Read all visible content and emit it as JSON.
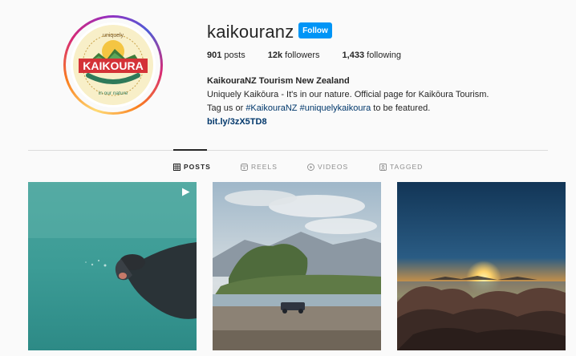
{
  "profile": {
    "username": "kaikouranz",
    "follow_label": "Follow",
    "logo_text": "KAIKOURA",
    "logo_top_text": "uniquely",
    "logo_bottom_text": "in our nature",
    "stats": {
      "posts_count": "901",
      "posts_label": "posts",
      "followers_count": "12k",
      "followers_label": "followers",
      "following_count": "1,433",
      "following_label": "following"
    },
    "bio": {
      "name": "KaikouraNZ Tourism New Zealand",
      "line1": "Uniquely Kaikōura - It's in our nature. Official page for Kaikōura Tourism.",
      "line2_prefix": "Tag us or ",
      "hashtag1": "#KaikouraNZ",
      "hashtag2": "#uniquelykaikoura",
      "line2_suffix": " to be featured.",
      "url": "bit.ly/3zX5TD8"
    }
  },
  "tabs": [
    {
      "label": "POSTS",
      "icon": "grid-icon",
      "active": true
    },
    {
      "label": "REELS",
      "icon": "reels-icon",
      "active": false
    },
    {
      "label": "VIDEOS",
      "icon": "play-circle-icon",
      "active": false
    },
    {
      "label": "TAGGED",
      "icon": "tagged-icon",
      "active": false
    }
  ],
  "posts": [
    {
      "subject": "underwater swimmer",
      "has_reel_icon": true
    },
    {
      "subject": "riverbed landscape with mountains",
      "has_reel_icon": false
    },
    {
      "subject": "sunset over rocky coast",
      "has_reel_icon": false
    }
  ],
  "colors": {
    "accent": "#0095f6",
    "link": "#00376b",
    "muted": "#8e8e8e",
    "text": "#262626"
  }
}
